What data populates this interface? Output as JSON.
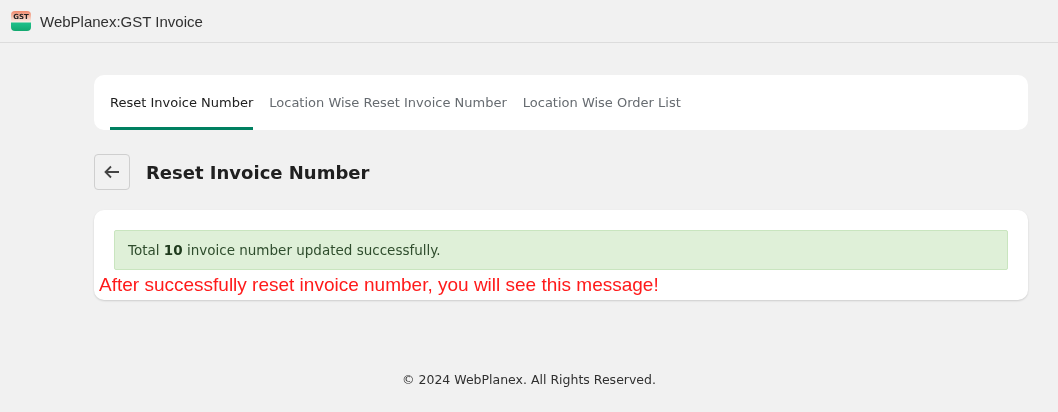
{
  "app_bar": {
    "logo": {
      "top": "GST"
    },
    "title": "WebPlanex:GST Invoice"
  },
  "tabs": [
    {
      "label": "Reset Invoice Number",
      "selected": true
    },
    {
      "label": "Location Wise Reset Invoice Number",
      "selected": false
    },
    {
      "label": "Location Wise Order List",
      "selected": false
    }
  ],
  "page": {
    "title": "Reset Invoice Number"
  },
  "alert": {
    "message": "Total **10** invoice number updated successfully."
  },
  "annotation": "After successfully reset invoice number, you will see this message!",
  "footer": "© 2024 WebPlanex. All Rights Reserved."
}
